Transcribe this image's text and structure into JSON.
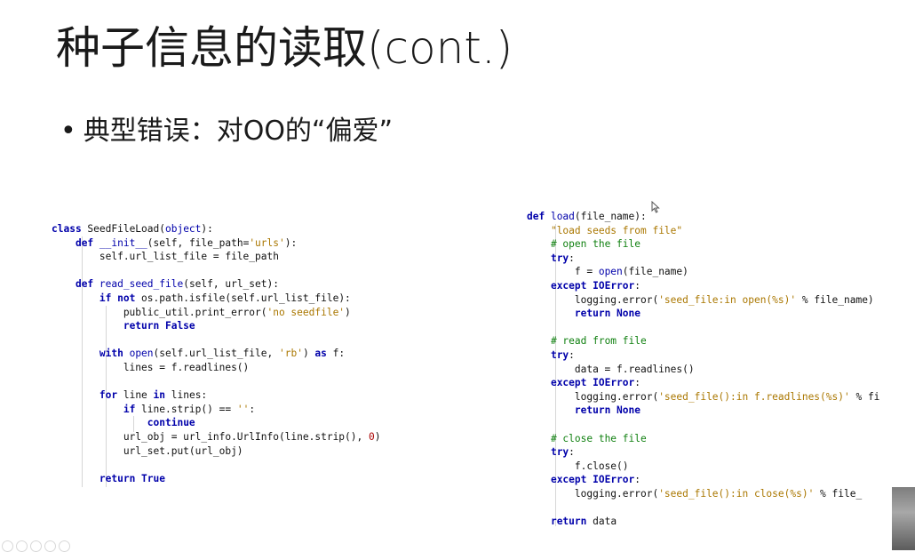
{
  "slide": {
    "title": "种子信息的读取(cont.)",
    "bullet_marker": "•",
    "bullet_text": "典型错误：对OO的“偏爱”"
  },
  "code_left": [
    [
      {
        "t": "class ",
        "c": "kw"
      },
      {
        "t": "SeedFileLoad(",
        "c": ""
      },
      {
        "t": "object",
        "c": "fn"
      },
      {
        "t": "):",
        "c": ""
      }
    ],
    [
      {
        "t": "    ",
        "c": ""
      },
      {
        "t": "def ",
        "c": "kw"
      },
      {
        "t": "__init__",
        "c": "fn"
      },
      {
        "t": "(self, file_path=",
        "c": ""
      },
      {
        "t": "'urls'",
        "c": "st"
      },
      {
        "t": "):",
        "c": ""
      }
    ],
    [
      {
        "t": "        self.url_list_file = file_path",
        "c": ""
      }
    ],
    [
      {
        "t": "",
        "c": ""
      }
    ],
    [
      {
        "t": "    ",
        "c": ""
      },
      {
        "t": "def ",
        "c": "kw"
      },
      {
        "t": "read_seed_file",
        "c": "fn"
      },
      {
        "t": "(self, url_set):",
        "c": ""
      }
    ],
    [
      {
        "t": "        ",
        "c": ""
      },
      {
        "t": "if not ",
        "c": "kw"
      },
      {
        "t": "os.path.isfile(self.url_list_file):",
        "c": ""
      }
    ],
    [
      {
        "t": "            public_util.print_error(",
        "c": ""
      },
      {
        "t": "'no seedfile'",
        "c": "st"
      },
      {
        "t": ")",
        "c": ""
      }
    ],
    [
      {
        "t": "            ",
        "c": ""
      },
      {
        "t": "return False",
        "c": "kw"
      }
    ],
    [
      {
        "t": "",
        "c": ""
      }
    ],
    [
      {
        "t": "        ",
        "c": ""
      },
      {
        "t": "with ",
        "c": "kw"
      },
      {
        "t": "open",
        "c": "fn"
      },
      {
        "t": "(self.url_list_file, ",
        "c": ""
      },
      {
        "t": "'rb'",
        "c": "st"
      },
      {
        "t": ") ",
        "c": ""
      },
      {
        "t": "as ",
        "c": "kw"
      },
      {
        "t": "f:",
        "c": ""
      }
    ],
    [
      {
        "t": "            lines = f.readlines()",
        "c": ""
      }
    ],
    [
      {
        "t": "",
        "c": ""
      }
    ],
    [
      {
        "t": "        ",
        "c": ""
      },
      {
        "t": "for ",
        "c": "kw"
      },
      {
        "t": "line ",
        "c": ""
      },
      {
        "t": "in ",
        "c": "kw"
      },
      {
        "t": "lines:",
        "c": ""
      }
    ],
    [
      {
        "t": "            ",
        "c": ""
      },
      {
        "t": "if ",
        "c": "kw"
      },
      {
        "t": "line.strip() == ",
        "c": ""
      },
      {
        "t": "''",
        "c": "st"
      },
      {
        "t": ":",
        "c": ""
      }
    ],
    [
      {
        "t": "                ",
        "c": ""
      },
      {
        "t": "continue",
        "c": "kw"
      }
    ],
    [
      {
        "t": "            url_obj = url_info.UrlInfo(line.strip(), ",
        "c": ""
      },
      {
        "t": "0",
        "c": "nm"
      },
      {
        "t": ")",
        "c": ""
      }
    ],
    [
      {
        "t": "            url_set.put(url_obj)",
        "c": ""
      }
    ],
    [
      {
        "t": "",
        "c": ""
      }
    ],
    [
      {
        "t": "        ",
        "c": ""
      },
      {
        "t": "return True",
        "c": "kw"
      }
    ]
  ],
  "code_right": [
    [
      {
        "t": "def ",
        "c": "kw"
      },
      {
        "t": "load",
        "c": "fn"
      },
      {
        "t": "(file_name):",
        "c": ""
      }
    ],
    [
      {
        "t": "    ",
        "c": ""
      },
      {
        "t": "\"load seeds from file\"",
        "c": "st"
      }
    ],
    [
      {
        "t": "    ",
        "c": ""
      },
      {
        "t": "# open the file",
        "c": "cm"
      }
    ],
    [
      {
        "t": "    ",
        "c": ""
      },
      {
        "t": "try",
        "c": "kw"
      },
      {
        "t": ":",
        "c": ""
      }
    ],
    [
      {
        "t": "        f = ",
        "c": ""
      },
      {
        "t": "open",
        "c": "fn"
      },
      {
        "t": "(file_name)",
        "c": ""
      }
    ],
    [
      {
        "t": "    ",
        "c": ""
      },
      {
        "t": "except ",
        "c": "kw"
      },
      {
        "t": "IOError",
        "c": "ex"
      },
      {
        "t": ":",
        "c": ""
      }
    ],
    [
      {
        "t": "        logging.error(",
        "c": ""
      },
      {
        "t": "'seed_file:in open(%s)'",
        "c": "st"
      },
      {
        "t": " % file_name)",
        "c": ""
      }
    ],
    [
      {
        "t": "        ",
        "c": ""
      },
      {
        "t": "return None",
        "c": "kw"
      }
    ],
    [
      {
        "t": "",
        "c": ""
      }
    ],
    [
      {
        "t": "    ",
        "c": ""
      },
      {
        "t": "# read from file",
        "c": "cm"
      }
    ],
    [
      {
        "t": "    ",
        "c": ""
      },
      {
        "t": "try",
        "c": "kw"
      },
      {
        "t": ":",
        "c": ""
      }
    ],
    [
      {
        "t": "        data = f.readlines()",
        "c": ""
      }
    ],
    [
      {
        "t": "    ",
        "c": ""
      },
      {
        "t": "except ",
        "c": "kw"
      },
      {
        "t": "IOError",
        "c": "ex"
      },
      {
        "t": ":",
        "c": ""
      }
    ],
    [
      {
        "t": "        logging.error(",
        "c": ""
      },
      {
        "t": "'seed_file():in f.readlines(%s)'",
        "c": "st"
      },
      {
        "t": " % fi",
        "c": ""
      }
    ],
    [
      {
        "t": "        ",
        "c": ""
      },
      {
        "t": "return None",
        "c": "kw"
      }
    ],
    [
      {
        "t": "",
        "c": ""
      }
    ],
    [
      {
        "t": "    ",
        "c": ""
      },
      {
        "t": "# close the file",
        "c": "cm"
      }
    ],
    [
      {
        "t": "    ",
        "c": ""
      },
      {
        "t": "try",
        "c": "kw"
      },
      {
        "t": ":",
        "c": ""
      }
    ],
    [
      {
        "t": "        f.close()",
        "c": ""
      }
    ],
    [
      {
        "t": "    ",
        "c": ""
      },
      {
        "t": "except ",
        "c": "kw"
      },
      {
        "t": "IOError",
        "c": "ex"
      },
      {
        "t": ":",
        "c": ""
      }
    ],
    [
      {
        "t": "        logging.error(",
        "c": ""
      },
      {
        "t": "'seed_file():in close(%s)'",
        "c": "st"
      },
      {
        "t": " % file_",
        "c": ""
      }
    ],
    [
      {
        "t": "",
        "c": ""
      }
    ],
    [
      {
        "t": "    ",
        "c": ""
      },
      {
        "t": "return ",
        "c": "kw"
      },
      {
        "t": "data",
        "c": ""
      }
    ]
  ],
  "icons": {
    "cursor": "mouse-pointer-icon",
    "presenter": "presenter-video-thumbnail"
  }
}
